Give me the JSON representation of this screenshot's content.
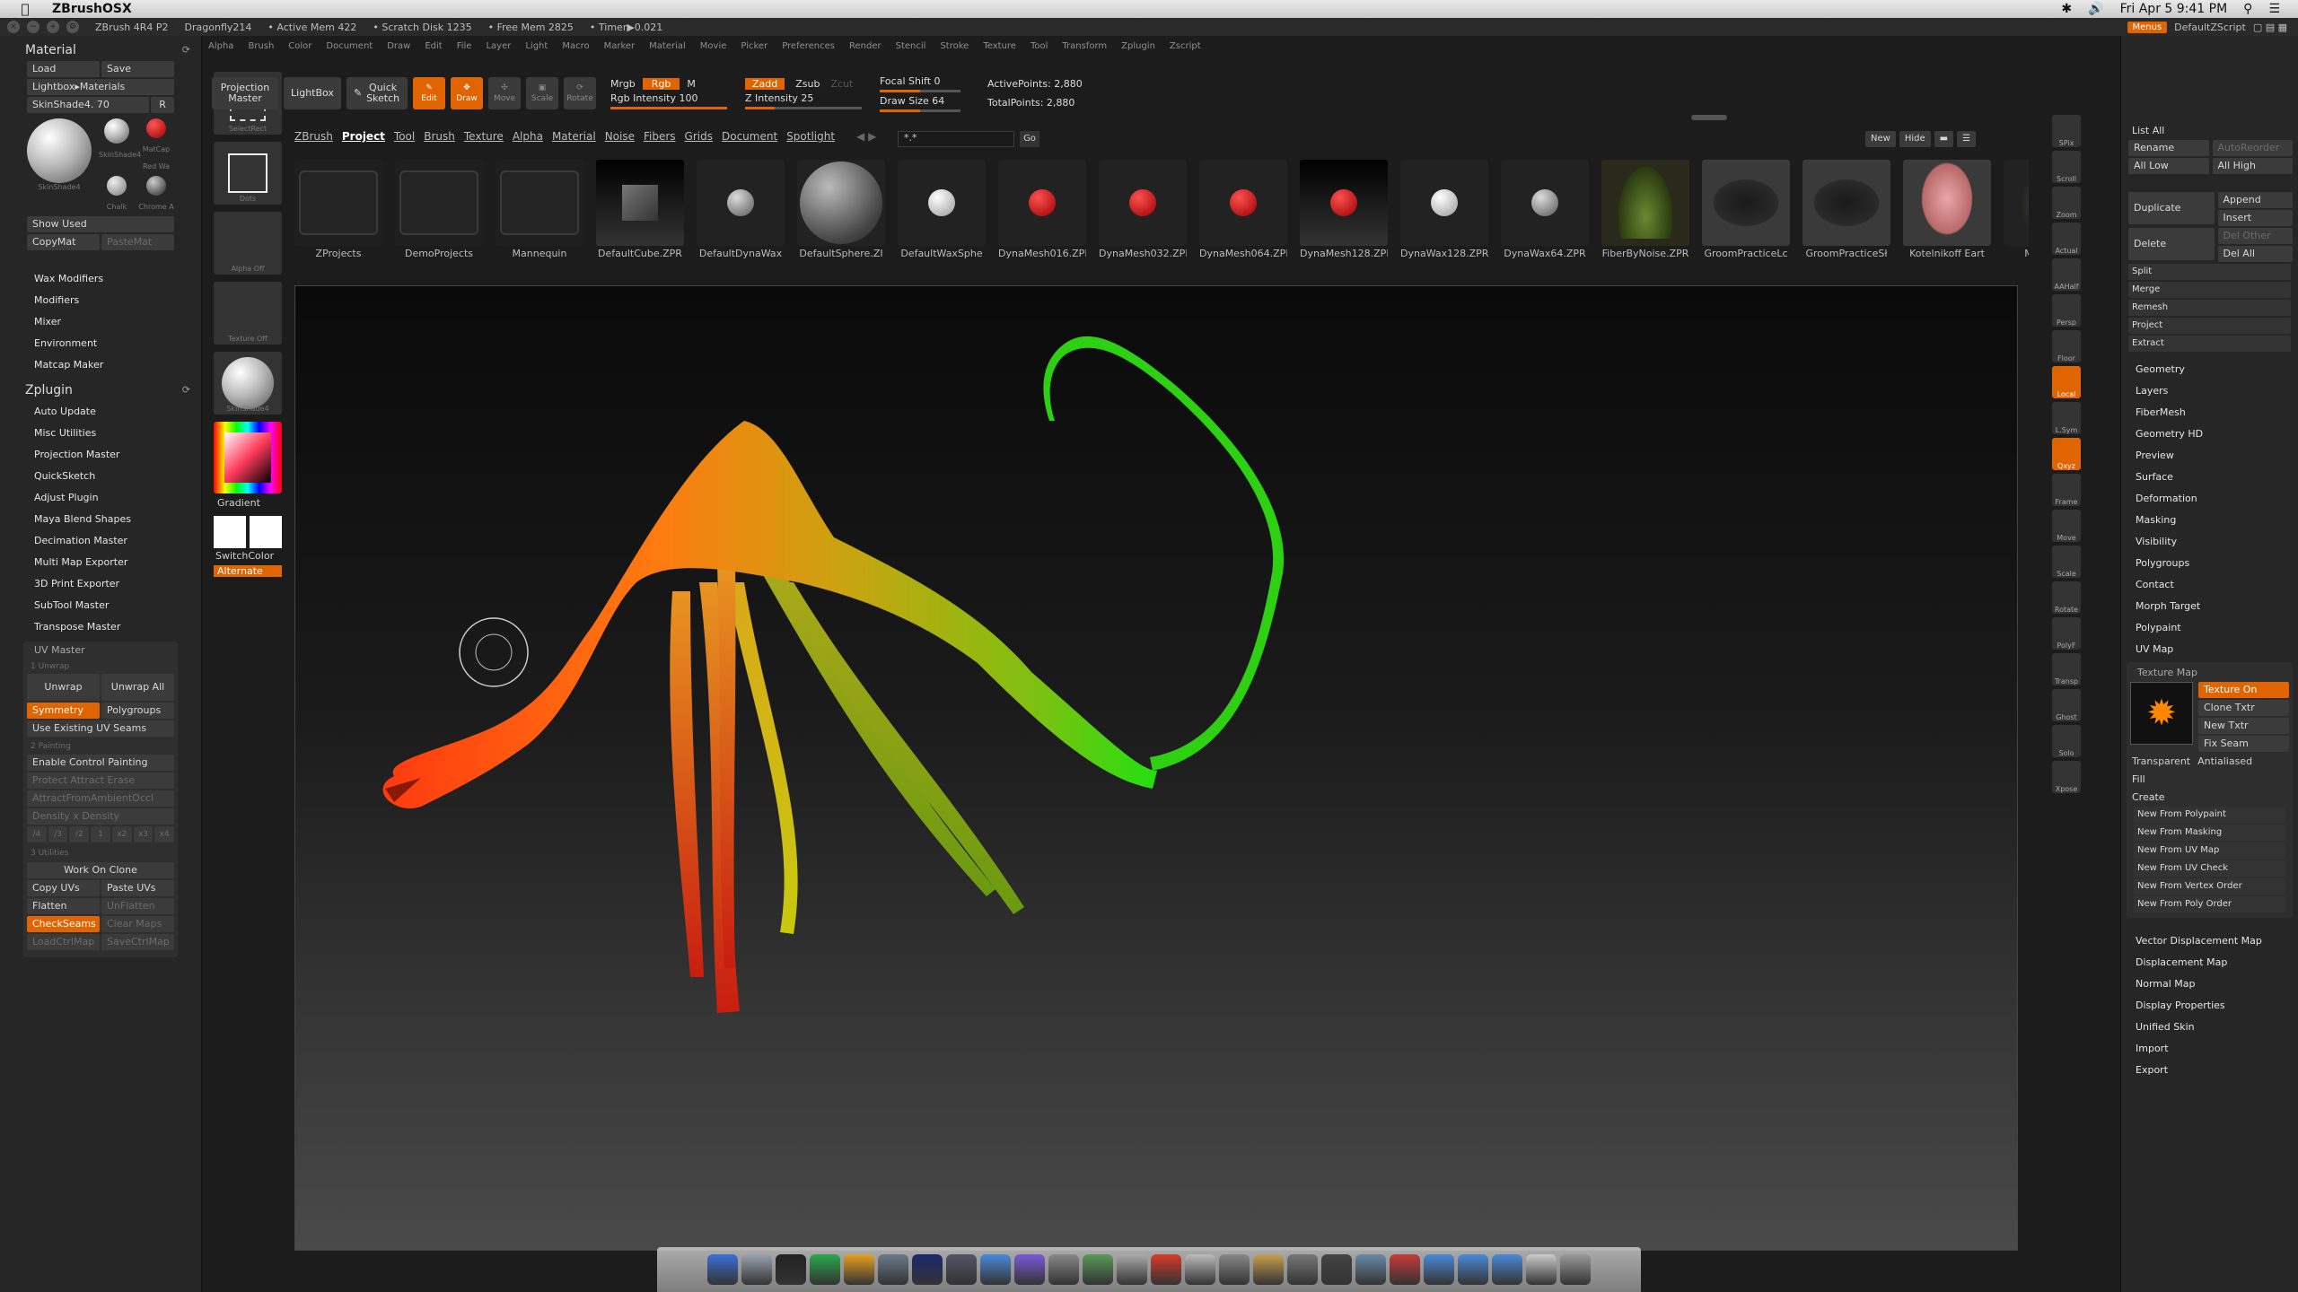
{
  "macbar": {
    "app_name": "ZBrushOSX",
    "clock": "Fri Apr 5  9:41 PM"
  },
  "titlebar": {
    "version": "ZBrush 4R4 P2",
    "doc": "Dragonfly214",
    "active_mem": "• Active Mem 422",
    "scratch": "• Scratch Disk 1235",
    "free_mem": "• Free Mem 2825",
    "timer": "• Timer▶0.021",
    "menus_btn": "Menus",
    "script": "DefaultZScript"
  },
  "main_menu": [
    "Alpha",
    "Brush",
    "Color",
    "Document",
    "Draw",
    "Edit",
    "File",
    "Layer",
    "Light",
    "Macro",
    "Marker",
    "Material",
    "Movie",
    "Picker",
    "Preferences",
    "Render",
    "Stencil",
    "Stroke",
    "Texture",
    "Tool",
    "Transform",
    "Zplugin",
    "Zscript"
  ],
  "left": {
    "material_title": "Material",
    "load": "Load",
    "save": "Save",
    "lightbox_materials": "Lightbox▸Materials",
    "skinshade": "SkinShade4. 70",
    "r": "R",
    "mat_labels": [
      "SkinShade4",
      "SkinShade4",
      "MatCap Red Wa",
      "Chalk",
      "Chrome A"
    ],
    "show_used": "Show Used",
    "copymat": "CopyMat",
    "pastemat": "PasteMat",
    "material_sub": [
      "Wax Modifiers",
      "Modifiers",
      "Mixer",
      "Environment",
      "Matcap Maker"
    ],
    "zplugin_title": "Zplugin",
    "zplugin_items": [
      "Auto Update",
      "Misc Utilities",
      "Projection Master",
      "QuickSketch",
      "Adjust Plugin",
      "Maya Blend Shapes",
      "Decimation Master",
      "Multi Map Exporter",
      "3D Print Exporter",
      "SubTool Master",
      "Transpose Master"
    ],
    "uv_master": "UV Master",
    "unwrap_hdr": "1 Unwrap",
    "unwrap": "Unwrap",
    "unwrap_all": "Unwrap All",
    "symmetry": "Symmetry",
    "polygroups": "Polygroups",
    "use_existing": "Use Existing UV Seams",
    "painting_hdr": "2 Painting",
    "enable_cp": "Enable Control Painting",
    "protect_attract": "Protect  Attract  Erase",
    "attract_ao": "AttractFromAmbientOccl",
    "density": "Density  x  Density",
    "density_vals": [
      "/4",
      "/3",
      "/2",
      "1",
      "x2",
      "x3",
      "x4"
    ],
    "utilities_hdr": "3 Utilities",
    "work_on_clone": "Work On Clone",
    "copy_uvs": "Copy UVs",
    "paste_uvs": "Paste UVs",
    "flatten": "Flatten",
    "unflatten": "UnFlatten",
    "checkseams": "CheckSeams",
    "clear_maps": "Clear Maps",
    "load_ctrl": "LoadCtrlMap",
    "save_ctrl": "SaveCtrlMap"
  },
  "shelf": {
    "select_rect": "SelectRect",
    "dots": "Dots",
    "alpha_off": "Alpha Off",
    "texture_off": "Texture Off",
    "mat": "SkinShade4",
    "gradient": "Gradient",
    "switchcolor": "SwitchColor",
    "alternate": "Alternate"
  },
  "toolbar": {
    "projection_master": "Projection Master",
    "lightbox": "LightBox",
    "quick_sketch": "Quick Sketch",
    "edit": "Edit",
    "draw": "Draw",
    "move": "Move",
    "scale": "Scale",
    "rotate": "Rotate",
    "mrgb": "Mrgb",
    "rgb": "Rgb",
    "m": "M",
    "rgb_intensity": "Rgb Intensity 100",
    "zadd": "Zadd",
    "zsub": "Zsub",
    "zcut": "Zcut",
    "z_intensity": "Z Intensity 25",
    "focal_shift": "Focal Shift 0",
    "draw_size": "Draw Size 64",
    "active_points": "ActivePoints: 2,880",
    "total_points": "TotalPoints: 2,880",
    "rgb_intensity_level": 1.0,
    "z_intensity_level": 0.25,
    "focal_shift_level": 0.5,
    "draw_size_level": 0.5
  },
  "lightbox_tabs": [
    "ZBrush",
    "Project",
    "Tool",
    "Brush",
    "Texture",
    "Alpha",
    "Material",
    "Noise",
    "Fibers",
    "Grids",
    "Document",
    "Spotlight"
  ],
  "lightbox_search": "*.*",
  "lightbox_go": "Go",
  "lightbox_new": "New",
  "lightbox_hide": "Hide",
  "lightbox_items": [
    {
      "label": "ZProjects",
      "kind": "folder"
    },
    {
      "label": "DemoProjects",
      "kind": "folder"
    },
    {
      "label": "Mannequin",
      "kind": "folder"
    },
    {
      "label": "DefaultCube.ZPR",
      "kind": "cube"
    },
    {
      "label": "DefaultDynaWax",
      "kind": "small-grey"
    },
    {
      "label": "DefaultSphere.ZI",
      "kind": "big-grey"
    },
    {
      "label": "DefaultWaxSphe",
      "kind": "small-white"
    },
    {
      "label": "DynaMesh016.ZPI",
      "kind": "red"
    },
    {
      "label": "DynaMesh032.ZPI",
      "kind": "red"
    },
    {
      "label": "DynaMesh064.ZPI",
      "kind": "red"
    },
    {
      "label": "DynaMesh128.ZPI",
      "kind": "red-dark"
    },
    {
      "label": "DynaWax128.ZPR",
      "kind": "small-white"
    },
    {
      "label": "DynaWax64.ZPR",
      "kind": "small-grey"
    },
    {
      "label": "FiberByNoise.ZPR",
      "kind": "grass"
    },
    {
      "label": "GroomPracticeLc",
      "kind": "dog"
    },
    {
      "label": "GroomPracticeSł",
      "kind": "dog"
    },
    {
      "label": "Kotelnikoff Eart",
      "kind": "ogre"
    },
    {
      "label": "MicroMes",
      "kind": "plant"
    }
  ],
  "nav": [
    "SPix",
    "Scroll",
    "Zoom",
    "Actual",
    "AAHalf",
    "Persp",
    "Floor",
    "Local",
    "L.Sym",
    "Qxyz",
    "Frame",
    "Move",
    "Scale",
    "Rotate",
    "PolyF",
    "Transp",
    "Ghost",
    "Solo",
    "Xpose"
  ],
  "right": {
    "list_all": "List All",
    "rename": "Rename",
    "auto_reorder": "AutoReorder",
    "all_low": "All Low",
    "all_high": "All High",
    "duplicate": "Duplicate",
    "append": "Append",
    "insert": "Insert",
    "delete": "Delete",
    "del_other": "Del Other",
    "del_all": "Del All",
    "split": "Split",
    "merge": "Merge",
    "remesh": "Remesh",
    "project": "Project",
    "extract": "Extract",
    "sections": [
      "Geometry",
      "Layers",
      "FiberMesh",
      "Geometry HD",
      "Preview",
      "Surface",
      "Deformation",
      "Masking",
      "Visibility",
      "Polygroups",
      "Contact",
      "Morph Target",
      "Polypaint",
      "UV Map"
    ],
    "texture_map": "Texture Map",
    "texture_on": "Texture On",
    "clone_txtr": "Clone Txtr",
    "new_txtr": "New Txtr",
    "fix_seam": "Fix Seam",
    "transparent": "Transparent",
    "antialiased": "Antialiased",
    "fill": "Fill",
    "create": "Create",
    "create_items": [
      "New From Polypaint",
      "New From Masking",
      "New From UV Map",
      "New From UV Check",
      "New From Vertex Order",
      "New From Poly Order"
    ],
    "sections2": [
      "Vector Displacement Map",
      "Displacement Map",
      "Normal Map",
      "Display Properties",
      "Unified Skin",
      "Import",
      "Export"
    ]
  },
  "colors": {
    "accent": "#e06400",
    "panel": "#262626",
    "canvas_top": "#0a0a0a",
    "canvas_bottom": "#4a4a4a"
  }
}
